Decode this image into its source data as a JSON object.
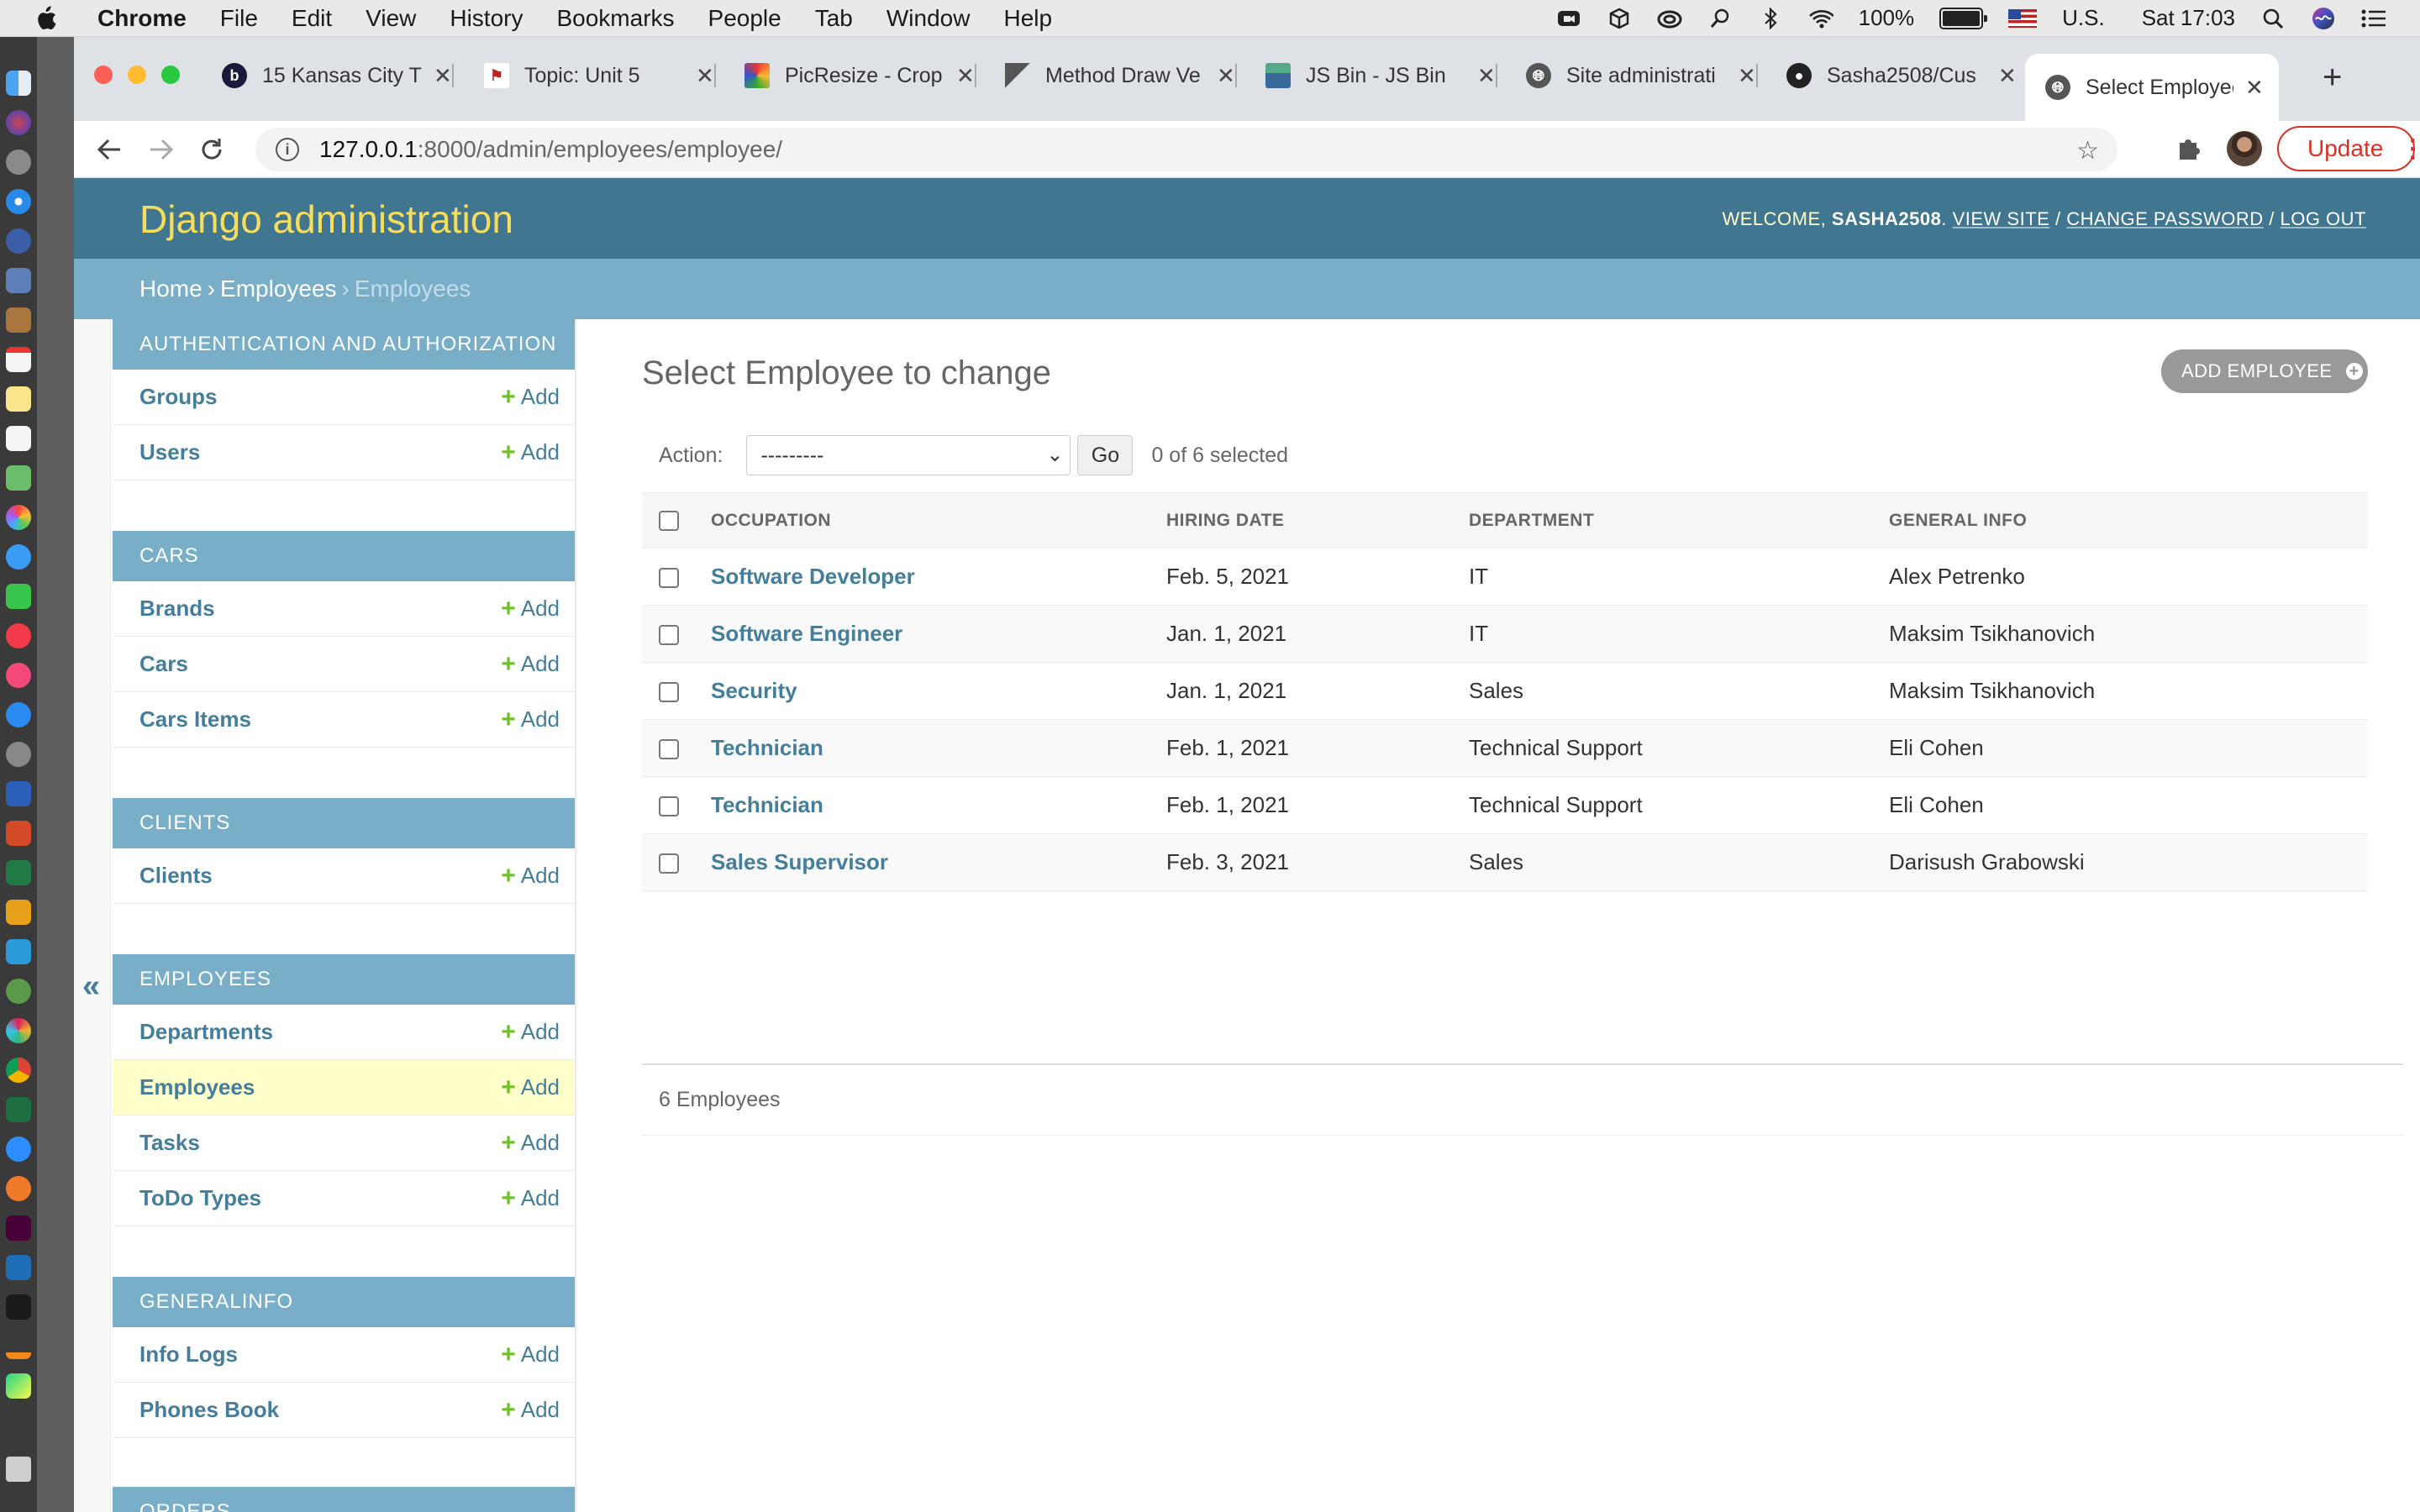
{
  "menubar": {
    "app": "Chrome",
    "items": [
      "File",
      "Edit",
      "View",
      "History",
      "Bookmarks",
      "People",
      "Tab",
      "Window",
      "Help"
    ],
    "battery": "100%",
    "battery_level": 1.0,
    "input_source": "U.S.",
    "clock": "Sat 17:03",
    "status_icons": [
      "zoom-icon",
      "box-icon",
      "creative-cloud-icon",
      "search-extension-icon",
      "bluetooth-icon",
      "wifi-icon",
      "battery-icon",
      "flag-icon",
      "spotlight-icon",
      "siri-icon",
      "control-center-icon"
    ]
  },
  "tabs": [
    {
      "title": "15 Kansas City T",
      "icon": "b-favicon",
      "color": "#1a1a3a"
    },
    {
      "title": "Topic: Unit 5",
      "icon": "red-flag-favicon",
      "color": "#b22"
    },
    {
      "title": "PicResize - Crop",
      "icon": "picresize-favicon",
      "color": "#e83"
    },
    {
      "title": "Method Draw Ve",
      "icon": "method-draw-favicon",
      "color": "#555"
    },
    {
      "title": "JS Bin - JS Bin",
      "icon": "jsbin-favicon",
      "color": "#5a8"
    },
    {
      "title": "Site administrati",
      "icon": "globe-favicon",
      "color": "#555"
    },
    {
      "title": "Sasha2508/Cus",
      "icon": "github-favicon",
      "color": "#222"
    },
    {
      "title": "Select Employee",
      "icon": "globe-favicon",
      "color": "#555",
      "active": true
    }
  ],
  "url": {
    "host": "127.0.0.1",
    "path": ":8000/admin/employees/employee/"
  },
  "update_label": "Update",
  "admin": {
    "site_name": "Django administration",
    "welcome": "WELCOME,",
    "user": "SASHA2508",
    "view_site": "VIEW SITE",
    "change_password": "CHANGE PASSWORD",
    "log_out": "LOG OUT",
    "breadcrumbs": [
      "Home",
      "Employees",
      "Employees"
    ]
  },
  "sidebar": {
    "add_label": "Add",
    "collapse_label": "«",
    "modules": [
      {
        "caption": "AUTHENTICATION AND AUTHORIZATION",
        "models": [
          "Groups",
          "Users"
        ]
      },
      {
        "caption": "CARS",
        "models": [
          "Brands",
          "Cars",
          "Cars Items"
        ]
      },
      {
        "caption": "CLIENTS",
        "models": [
          "Clients"
        ]
      },
      {
        "caption": "EMPLOYEES",
        "models": [
          "Departments",
          "Employees",
          "Tasks",
          "ToDo Types"
        ],
        "current": "Employees"
      },
      {
        "caption": "GENERALINFO",
        "models": [
          "Info Logs",
          "Phones Book"
        ]
      },
      {
        "caption": "ORDERS",
        "models": []
      }
    ]
  },
  "content": {
    "title": "Select Employee to change",
    "add_button": "ADD EMPLOYEE",
    "action_label": "Action:",
    "action_value": "---------",
    "go_label": "Go",
    "counter": "0 of 6 selected",
    "columns": [
      "OCCUPATION",
      "HIRING DATE",
      "DEPARTMENT",
      "GENERAL INFO"
    ],
    "rows": [
      [
        "Software Developer",
        "Feb. 5, 2021",
        "IT",
        "Alex Petrenko"
      ],
      [
        "Software Engineer",
        "Jan. 1, 2021",
        "IT",
        "Maksim Tsikhanovich"
      ],
      [
        "Security",
        "Jan. 1, 2021",
        "Sales",
        "Maksim Tsikhanovich"
      ],
      [
        "Technician",
        "Feb. 1, 2021",
        "Technical Support",
        "Eli Cohen"
      ],
      [
        "Technician",
        "Feb. 1, 2021",
        "Technical Support",
        "Eli Cohen"
      ],
      [
        "Sales Supervisor",
        "Feb. 3, 2021",
        "Sales",
        "Darisush Grabowski"
      ]
    ],
    "paginator": "6 Employees"
  }
}
